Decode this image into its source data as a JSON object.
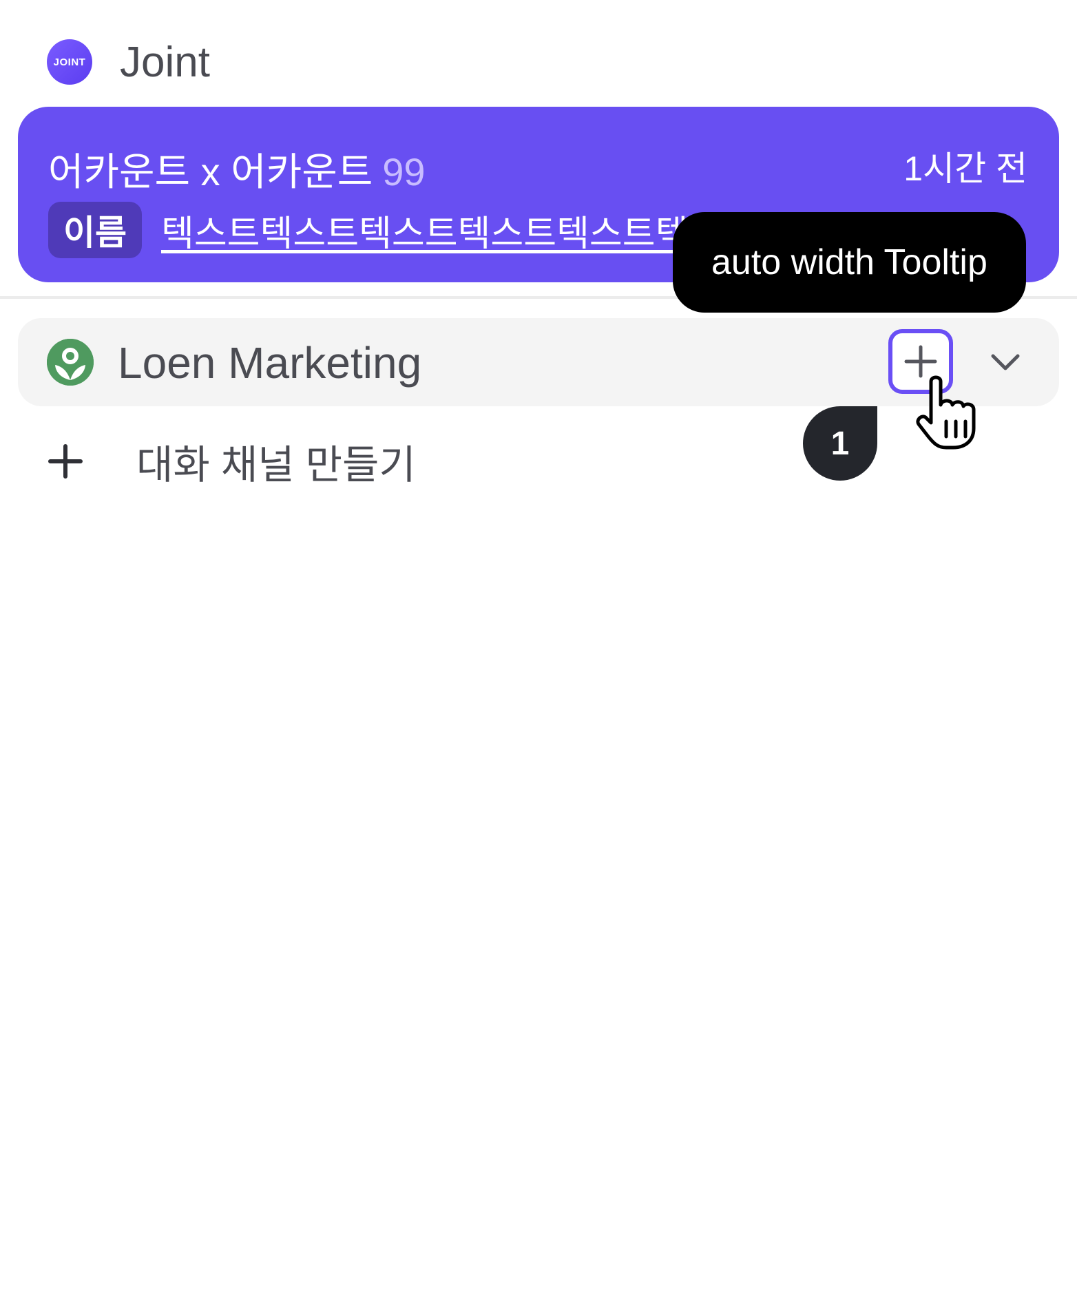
{
  "header": {
    "logo_text": "JOINT",
    "title": "Joint"
  },
  "account_card": {
    "title": "어카운트 x 어카운트",
    "count": "99",
    "time": "1시간 전",
    "name_chip": "이름",
    "preview": "텍스트텍스트텍스트텍스트텍스트텍스트텍스트"
  },
  "workspace": {
    "name": "Loen Marketing"
  },
  "create_channel": {
    "label": "대화 채널 만들기"
  },
  "tooltip": {
    "text": "auto width Tooltip"
  },
  "step_badge": {
    "number": "1"
  },
  "colors": {
    "accent": "#684ff2",
    "focus_border": "#6a4ff5",
    "workspace_logo": "#4f9a5f",
    "tooltip_bg": "#000000",
    "badge_bg": "#24262c"
  },
  "icons": {
    "add": "plus-icon",
    "expand": "chevron-down-icon",
    "cursor": "hand-pointer-icon",
    "workspace": "sprout-icon"
  }
}
